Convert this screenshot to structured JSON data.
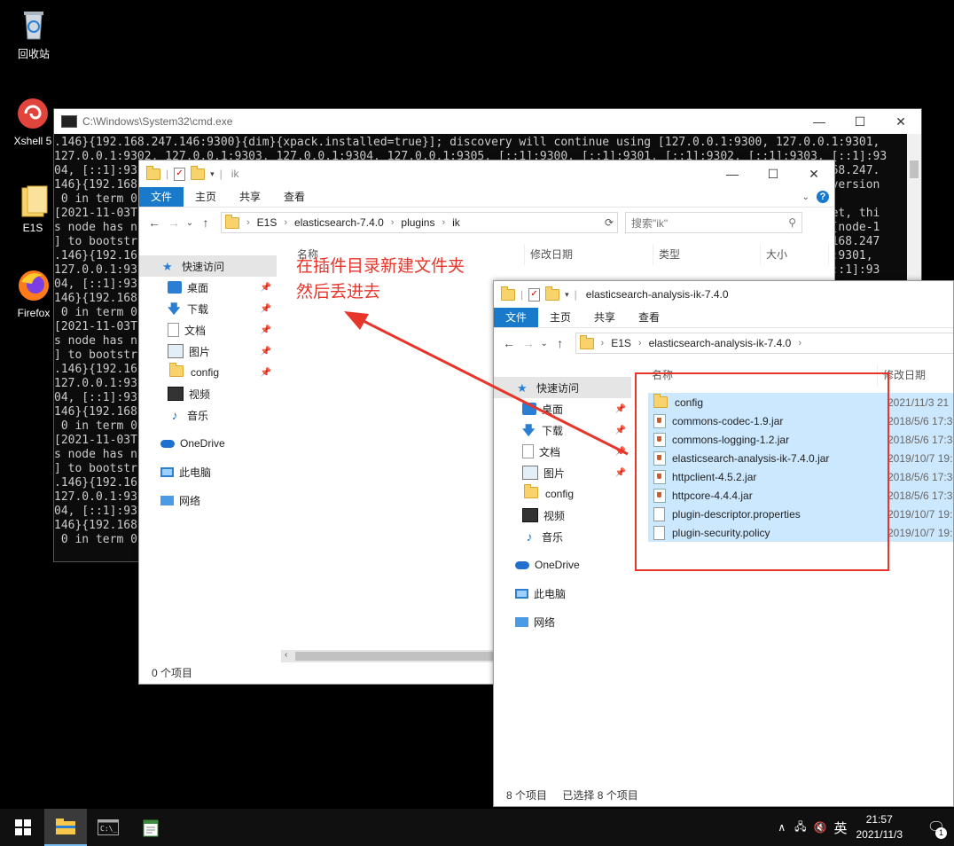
{
  "desktop": {
    "icons": [
      {
        "label": "回收站"
      },
      {
        "label": "Xshell 5"
      },
      {
        "label": "E1S"
      },
      {
        "label": "Firefox"
      }
    ]
  },
  "cmd": {
    "title": "C:\\Windows\\System32\\cmd.exe",
    "lines": [
      ".146}{192.168.247.146:9300}{dim}{xpack.installed=true}]; discovery will continue using [127.0.0.1:9300, 127.0.0.1:9301,",
      "127.0.0.1:9302, 127.0.0.1:9303, 127.0.0.1:9304, 127.0.0.1:9305, [::1]:9300, [::1]:9301, [::1]:9302, [::1]:9303, [::1]:93",
      "04, [::1]:93                                                                                                 2.168.247.",
      "146}{192.168                                                                                                 ed version",
      " 0 in term 0",
      "[2021-11-03T                                                                                                 d yet, thi",
      "s node has n                                                                                                 es [node-1",
      "] to bootstr                                                                                                 92.168.247",
      ".146}{192.16                                                                                                 0.1:9301,",
      "127.0.0.1:93                                                                                                 , [::1]:93",
      "04, [::1]:93",
      "146}{192.168",
      " 0 in term 0",
      "[2021-11-03T",
      "s node has n",
      "] to bootstr",
      ".146}{192.16",
      "127.0.0.1:93",
      "04, [::1]:93",
      "146}{192.168",
      " 0 in term 0",
      "[2021-11-03T",
      "s node has n",
      "] to bootstr",
      ".146}{192.16",
      "127.0.0.1:93",
      "04, [::1]:93",
      "146}{192.168",
      " 0 in term 0"
    ]
  },
  "ribbon_tabs": {
    "file": "文件",
    "home": "主页",
    "share": "共享",
    "view": "查看"
  },
  "help_glyph": "?",
  "explorer1": {
    "title": "ik",
    "path": [
      "E1S",
      "elasticsearch-7.4.0",
      "plugins",
      "ik"
    ],
    "search_placeholder": "搜索\"ik\"",
    "columns": [
      "名称",
      "修改日期",
      "类型",
      "大小"
    ],
    "sidebar": [
      {
        "label": "快速访问",
        "icon": "star-icon"
      },
      {
        "label": "桌面",
        "icon": "desktop-icon",
        "pinned": true
      },
      {
        "label": "下载",
        "icon": "download-icon",
        "pinned": true
      },
      {
        "label": "文档",
        "icon": "documents-icon",
        "pinned": true
      },
      {
        "label": "图片",
        "icon": "pictures-icon",
        "pinned": true
      },
      {
        "label": "config",
        "icon": "folder-icon",
        "pinned": true
      },
      {
        "label": "视频",
        "icon": "videos-icon"
      },
      {
        "label": "音乐",
        "icon": "music-icon"
      },
      {
        "label": "OneDrive",
        "icon": "onedrive-icon"
      },
      {
        "label": "此电脑",
        "icon": "this-pc-icon"
      },
      {
        "label": "网络",
        "icon": "network-icon"
      }
    ],
    "status": "0 个项目"
  },
  "explorer2": {
    "title": "elasticsearch-analysis-ik-7.4.0",
    "path": [
      "E1S",
      "elasticsearch-analysis-ik-7.4.0"
    ],
    "columns": [
      "名称",
      "修改日期"
    ],
    "sidebar": [
      {
        "label": "快速访问"
      },
      {
        "label": "桌面"
      },
      {
        "label": "下载"
      },
      {
        "label": "文档"
      },
      {
        "label": "图片"
      },
      {
        "label": "config"
      },
      {
        "label": "视频"
      },
      {
        "label": "音乐"
      },
      {
        "label": "OneDrive"
      },
      {
        "label": "此电脑"
      },
      {
        "label": "网络"
      }
    ],
    "files": [
      {
        "name": "config",
        "date": "2021/11/3 21",
        "type": "folder"
      },
      {
        "name": "commons-codec-1.9.jar",
        "date": "2018/5/6 17:3",
        "type": "jar"
      },
      {
        "name": "commons-logging-1.2.jar",
        "date": "2018/5/6 17:3",
        "type": "jar"
      },
      {
        "name": "elasticsearch-analysis-ik-7.4.0.jar",
        "date": "2019/10/7 19:",
        "type": "jar"
      },
      {
        "name": "httpclient-4.5.2.jar",
        "date": "2018/5/6 17:3",
        "type": "jar"
      },
      {
        "name": "httpcore-4.4.4.jar",
        "date": "2018/5/6 17:3",
        "type": "jar"
      },
      {
        "name": "plugin-descriptor.properties",
        "date": "2019/10/7 19:",
        "type": "doc"
      },
      {
        "name": "plugin-security.policy",
        "date": "2019/10/7 19:",
        "type": "doc"
      }
    ],
    "status_count": "8 个项目",
    "status_selected": "已选择 8 个项目"
  },
  "annotation": {
    "line1": "在插件目录新建文件夹",
    "line2": "然后丢进去",
    "color": "#e8352a"
  },
  "taskbar": {
    "time": "21:57",
    "date": "2021/11/3",
    "ime": "英",
    "notification_count": "1"
  }
}
